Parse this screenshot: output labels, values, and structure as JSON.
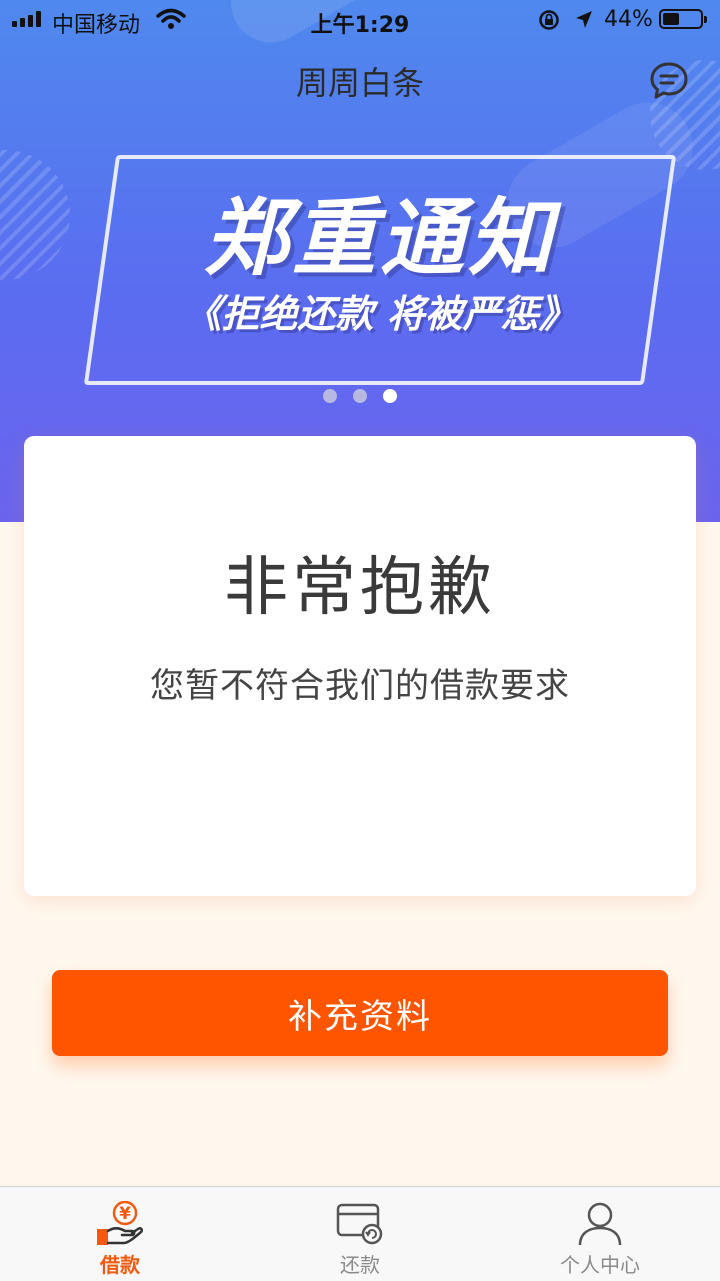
{
  "status_bar": {
    "carrier": "中国移动",
    "time": "上午1:29",
    "battery_pct": "44%",
    "battery_level": 0.44
  },
  "nav": {
    "title": "周周白条",
    "message_icon": "chat-bubble-icon"
  },
  "banner": {
    "headline": "郑重通知",
    "subline": "《拒绝还款 将被严惩》",
    "dots": 3,
    "active_dot": 3
  },
  "card": {
    "title": "非常抱歉",
    "message": "您暂不符合我们的借款要求"
  },
  "action": {
    "button_label": "补充资料"
  },
  "tabs": [
    {
      "label": "借款",
      "icon": "hand-yen-icon",
      "active": true
    },
    {
      "label": "还款",
      "icon": "card-refresh-icon",
      "active": false
    },
    {
      "label": "个人中心",
      "icon": "person-icon",
      "active": false
    }
  ],
  "colors": {
    "accent": "#ff5500",
    "tab_active": "#f25a12",
    "hero_top": "#4f89ee",
    "hero_bottom": "#6b63ee",
    "page_bg": "#fff8ef"
  }
}
